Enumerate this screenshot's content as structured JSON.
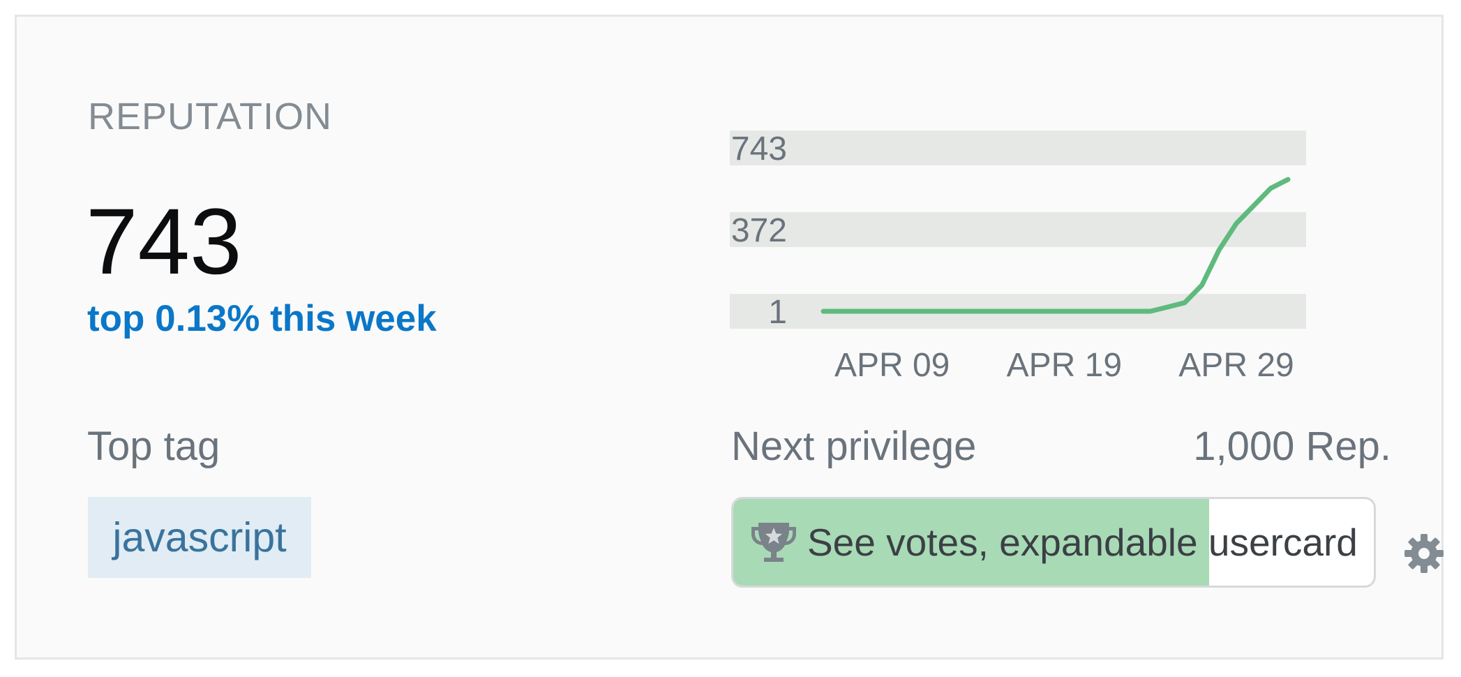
{
  "reputation": {
    "label": "REPUTATION",
    "value": "743",
    "rank_text": "top 0.13% this week"
  },
  "top_tag": {
    "label": "Top tag",
    "tag": "javascript"
  },
  "chart_data": {
    "type": "line",
    "y_ticks": [
      "743",
      "372",
      "1"
    ],
    "x_ticks": [
      "APR 09",
      "APR 19",
      "APR 29"
    ],
    "x": [
      "Apr 05",
      "Apr 06",
      "Apr 07",
      "Apr 08",
      "Apr 09",
      "Apr 10",
      "Apr 11",
      "Apr 12",
      "Apr 13",
      "Apr 14",
      "Apr 15",
      "Apr 16",
      "Apr 17",
      "Apr 18",
      "Apr 19",
      "Apr 20",
      "Apr 21",
      "Apr 22",
      "Apr 23",
      "Apr 24",
      "Apr 25",
      "Apr 26",
      "Apr 27",
      "Apr 28",
      "Apr 29",
      "Apr 30",
      "May 01",
      "May 02"
    ],
    "values": [
      1,
      1,
      1,
      1,
      1,
      1,
      1,
      1,
      1,
      1,
      1,
      1,
      1,
      1,
      1,
      1,
      1,
      1,
      1,
      1,
      20,
      40,
      120,
      280,
      400,
      480,
      560,
      600
    ],
    "ylim": [
      1,
      743
    ],
    "color": "#5eba7d",
    "band_color": "#e6e8e6"
  },
  "next_privilege": {
    "label": "Next privilege",
    "rep_needed": "1,000 Rep.",
    "privilege_text": "See votes, expandable usercard",
    "progress_percent": 74.3,
    "fill_color": "#a8dab5"
  },
  "icons": {
    "trophy": "trophy-icon",
    "settings": "gear-icon"
  }
}
